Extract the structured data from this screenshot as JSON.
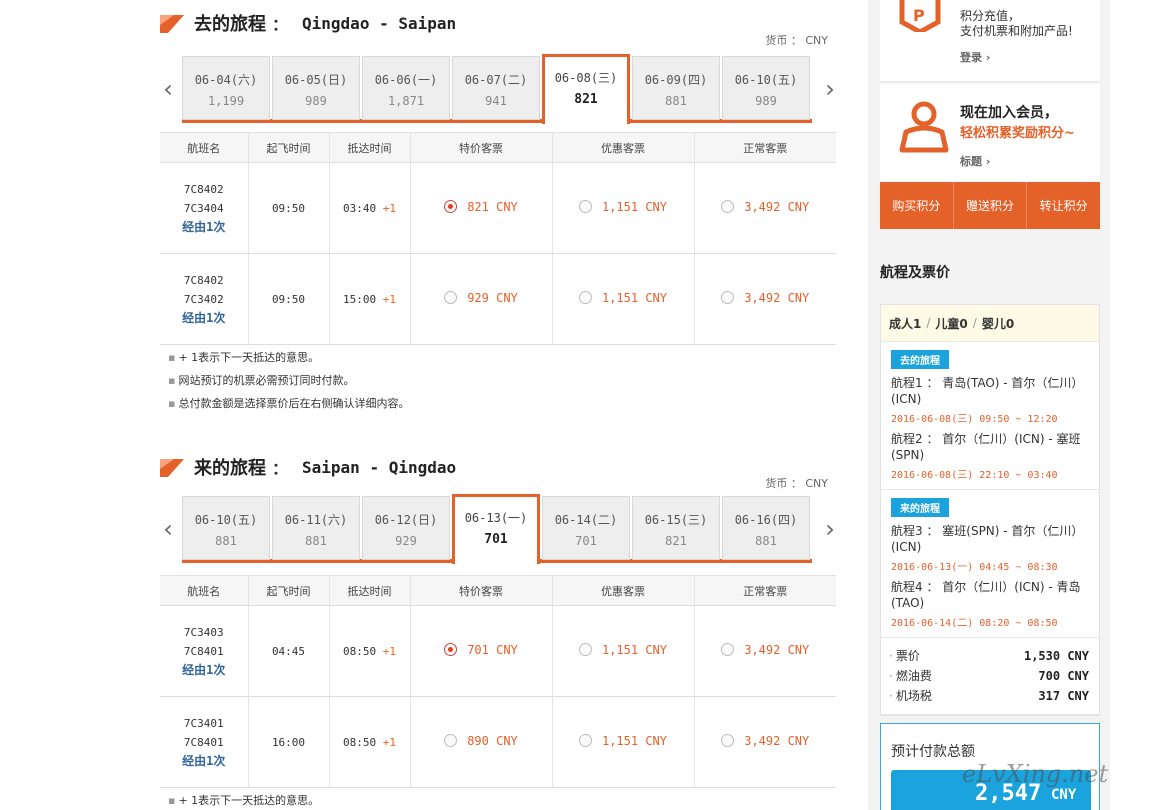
{
  "outbound": {
    "title": "去的旅程",
    "colon": "：",
    "route": "Qingdao - Saipan",
    "currency": "货币 ： CNY",
    "dates": [
      {
        "d": "06-04(六)",
        "p": "1,199",
        "active": false
      },
      {
        "d": "06-05(日)",
        "p": "989",
        "active": false
      },
      {
        "d": "06-06(一)",
        "p": "1,871",
        "active": false
      },
      {
        "d": "06-07(二)",
        "p": "941",
        "active": false
      },
      {
        "d": "06-08(三)",
        "p": "821",
        "active": true
      },
      {
        "d": "06-09(四)",
        "p": "881",
        "active": false
      },
      {
        "d": "06-10(五)",
        "p": "989",
        "active": false
      }
    ],
    "headers": [
      "航班名",
      "起飞时间",
      "抵达时间",
      "特价客票",
      "优惠客票",
      "正常客票"
    ],
    "rows": [
      {
        "f1": "7C8402",
        "f2": "7C3404",
        "via": "经由1次",
        "dep": "09:50",
        "arr": "03:40",
        "plus": "+1",
        "fare1": "821 CNY",
        "fare2": "1,151 CNY",
        "fare3": "3,492 CNY",
        "sel": true
      },
      {
        "f1": "7C8402",
        "f2": "7C3402",
        "via": "经由1次",
        "dep": "09:50",
        "arr": "15:00",
        "plus": "+1",
        "fare1": "929 CNY",
        "fare2": "1,151 CNY",
        "fare3": "3,492 CNY",
        "sel": false
      }
    ],
    "notes": [
      "+ 1表示下一天抵达的意思。",
      "网站预订的机票必需预订同时付款。",
      "总付款金额是选择票价后在右侧确认详细内容。"
    ]
  },
  "inbound": {
    "title": "来的旅程",
    "colon": "：",
    "route": "Saipan - Qingdao",
    "currency": "货币 ： CNY",
    "dates": [
      {
        "d": "06-10(五)",
        "p": "881",
        "active": false
      },
      {
        "d": "06-11(六)",
        "p": "881",
        "active": false
      },
      {
        "d": "06-12(日)",
        "p": "929",
        "active": false
      },
      {
        "d": "06-13(一)",
        "p": "701",
        "active": true
      },
      {
        "d": "06-14(二)",
        "p": "701",
        "active": false
      },
      {
        "d": "06-15(三)",
        "p": "821",
        "active": false
      },
      {
        "d": "06-16(四)",
        "p": "881",
        "active": false
      }
    ],
    "headers": [
      "航班名",
      "起飞时间",
      "抵达时间",
      "特价客票",
      "优惠客票",
      "正常客票"
    ],
    "rows": [
      {
        "f1": "7C3403",
        "f2": "7C8401",
        "via": "经由1次",
        "dep": "04:45",
        "arr": "08:50",
        "plus": "+1",
        "fare1": "701 CNY",
        "fare2": "1,151 CNY",
        "fare3": "3,492 CNY",
        "sel": true
      },
      {
        "f1": "7C3401",
        "f2": "7C8401",
        "via": "经由1次",
        "dep": "16:00",
        "arr": "08:50",
        "plus": "+1",
        "fare1": "890 CNY",
        "fare2": "1,151 CNY",
        "fare3": "3,492 CNY",
        "sel": false
      }
    ],
    "notes": [
      "+ 1表示下一天抵达的意思。"
    ]
  },
  "sidebar": {
    "points_text1": "积分充值，",
    "points_text2": "支付机票和附加产品!",
    "login": "登录 ›",
    "join_title": "现在加入会员，",
    "join_sub": "轻松积累奖励积分~",
    "join_link": "标题 ›",
    "buttons": [
      "购买积分",
      "赠送积分",
      "转让积分"
    ],
    "heading": "航程及票价",
    "pax": {
      "adult": "成人1",
      "child": "儿童0",
      "infant": "婴儿0",
      "sep": "/"
    },
    "out_badge": "去的旅程",
    "in_badge": "来的旅程",
    "legs_out": [
      {
        "n": "航程1 ： 青岛(TAO) - 首尔（仁川）(ICN)",
        "t": "2016-06-08(三) 09:50 ~ 12:20"
      },
      {
        "n": "航程2 ： 首尔（仁川）(ICN) - 塞班(SPN)",
        "t": "2016-06-08(三) 22:10 ~ 03:40"
      }
    ],
    "legs_in": [
      {
        "n": "航程3 ： 塞班(SPN) - 首尔（仁川）(ICN)",
        "t": "2016-06-13(一) 04:45 ~ 08:30"
      },
      {
        "n": "航程4 ： 首尔（仁川）(ICN) - 青岛(TAO)",
        "t": "2016-06-14(二) 08:20 ~ 08:50"
      }
    ],
    "costs": [
      {
        "k": "票价",
        "v": "1,530 CNY"
      },
      {
        "k": "燃油费",
        "v": "700 CNY"
      },
      {
        "k": "机场税",
        "v": "317 CNY"
      }
    ],
    "total_label": "预计付款总额",
    "total_amount": "2,547",
    "total_currency": "CNY"
  },
  "watermark": "eLvXing.net",
  "colors": {
    "accent": "#e5612a",
    "blue": "#1aa3dd"
  }
}
